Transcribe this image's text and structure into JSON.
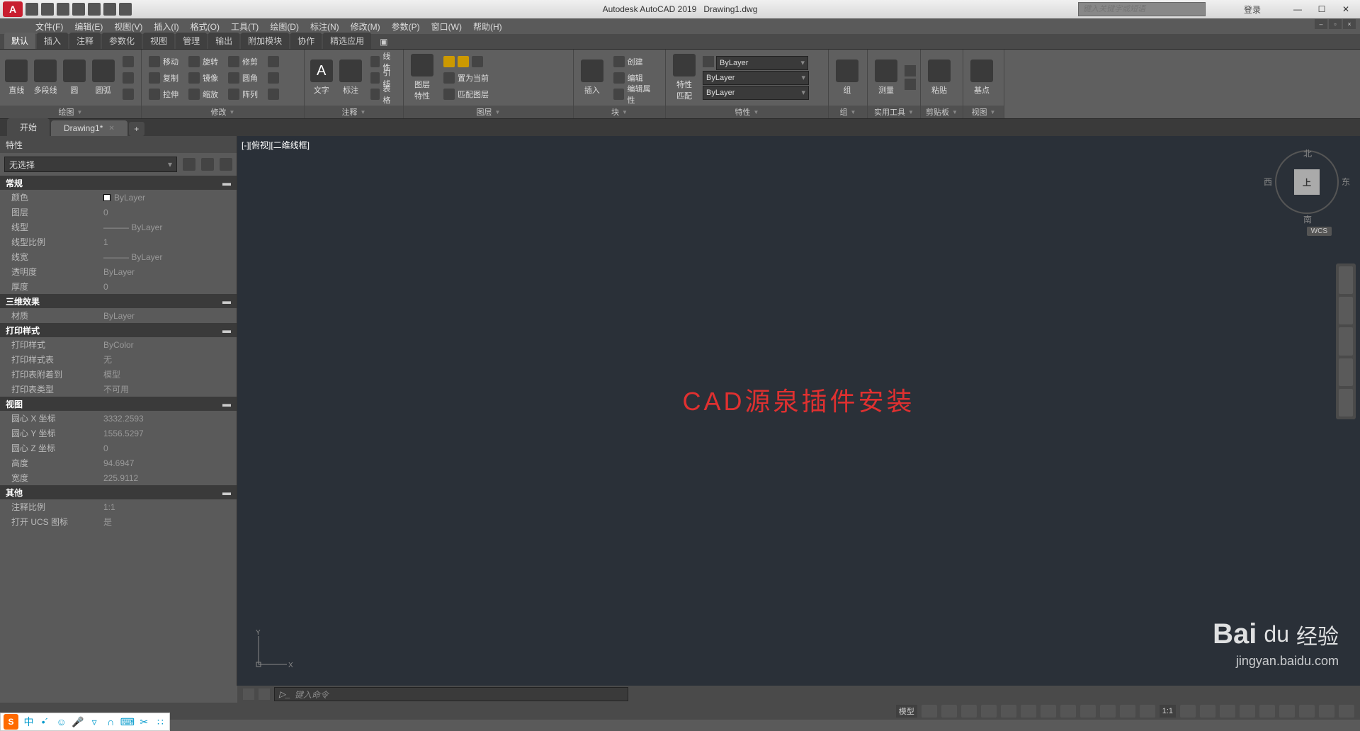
{
  "title": {
    "app": "Autodesk AutoCAD 2019",
    "file": "Drawing1.dwg"
  },
  "search_placeholder": "键入关键字或短语",
  "login_label": "登录",
  "menubar": [
    "文件(F)",
    "编辑(E)",
    "视图(V)",
    "插入(I)",
    "格式(O)",
    "工具(T)",
    "绘图(D)",
    "标注(N)",
    "修改(M)",
    "参数(P)",
    "窗口(W)",
    "帮助(H)"
  ],
  "ribbon_tabs": [
    "默认",
    "插入",
    "注释",
    "参数化",
    "视图",
    "管理",
    "输出",
    "附加模块",
    "协作",
    "精选应用"
  ],
  "ribbon": {
    "draw": {
      "title": "绘图",
      "items": [
        "直线",
        "多段线",
        "圆",
        "圆弧"
      ]
    },
    "modify": {
      "title": "修改",
      "row1": [
        "移动",
        "旋转",
        "修剪"
      ],
      "row2": [
        "复制",
        "镜像",
        "圆角"
      ],
      "row3": [
        "拉伸",
        "缩放",
        "阵列"
      ]
    },
    "annot": {
      "title": "注释",
      "items": [
        "文字",
        "标注"
      ],
      "sub": [
        "线性",
        "引线",
        "表格"
      ]
    },
    "layer": {
      "title": "图层",
      "main": "图层\n特性",
      "items": [
        "置为当前",
        "匹配图层"
      ]
    },
    "block": {
      "title": "块",
      "main": "插入",
      "items": [
        "创建",
        "编辑",
        "编辑属性"
      ]
    },
    "props": {
      "title": "特性",
      "main": "特性\n匹配",
      "dd1": "ByLayer",
      "dd2": "ByLayer",
      "dd3": "ByLayer"
    },
    "group": {
      "title": "组",
      "main": "组"
    },
    "util": {
      "title": "实用工具",
      "main": "测量"
    },
    "clip": {
      "title": "剪贴板",
      "main": "粘贴"
    },
    "view": {
      "title": "视图",
      "main": "基点"
    }
  },
  "filetabs": {
    "start": "开始",
    "drawing": "Drawing1*"
  },
  "properties": {
    "title": "特性",
    "selection": "无选择",
    "sections": [
      {
        "name": "常规",
        "rows": [
          {
            "k": "颜色",
            "v": "ByLayer",
            "swatch": true
          },
          {
            "k": "图层",
            "v": "0"
          },
          {
            "k": "线型",
            "v": "——— ByLayer"
          },
          {
            "k": "线型比例",
            "v": "1"
          },
          {
            "k": "线宽",
            "v": "——— ByLayer"
          },
          {
            "k": "透明度",
            "v": "ByLayer"
          },
          {
            "k": "厚度",
            "v": "0"
          }
        ]
      },
      {
        "name": "三维效果",
        "rows": [
          {
            "k": "材质",
            "v": "ByLayer"
          }
        ]
      },
      {
        "name": "打印样式",
        "rows": [
          {
            "k": "打印样式",
            "v": "ByColor"
          },
          {
            "k": "打印样式表",
            "v": "无"
          },
          {
            "k": "打印表附着到",
            "v": "模型"
          },
          {
            "k": "打印表类型",
            "v": "不可用"
          }
        ]
      },
      {
        "name": "视图",
        "rows": [
          {
            "k": "圆心 X 坐标",
            "v": "3332.2593"
          },
          {
            "k": "圆心 Y 坐标",
            "v": "1556.5297"
          },
          {
            "k": "圆心 Z 坐标",
            "v": "0"
          },
          {
            "k": "高度",
            "v": "94.6947"
          },
          {
            "k": "宽度",
            "v": "225.9112"
          }
        ]
      },
      {
        "name": "其他",
        "rows": [
          {
            "k": "注释比例",
            "v": "1:1"
          },
          {
            "k": "打开 UCS 图标",
            "v": "是"
          }
        ]
      }
    ]
  },
  "viewport_label": "[-][俯视][二维线框]",
  "viewcube": {
    "top": "上",
    "n": "北",
    "s": "南",
    "w": "西",
    "e": "东",
    "wcs": "WCS"
  },
  "overlay_text": "CAD源泉插件安装",
  "cmd_placeholder": "键入命令",
  "status": {
    "model": "模型",
    "scale": "1:1"
  },
  "watermark": {
    "brand": "Baidu 经验",
    "url": "jingyan.baidu.com"
  },
  "ime": {
    "lang": "中"
  }
}
